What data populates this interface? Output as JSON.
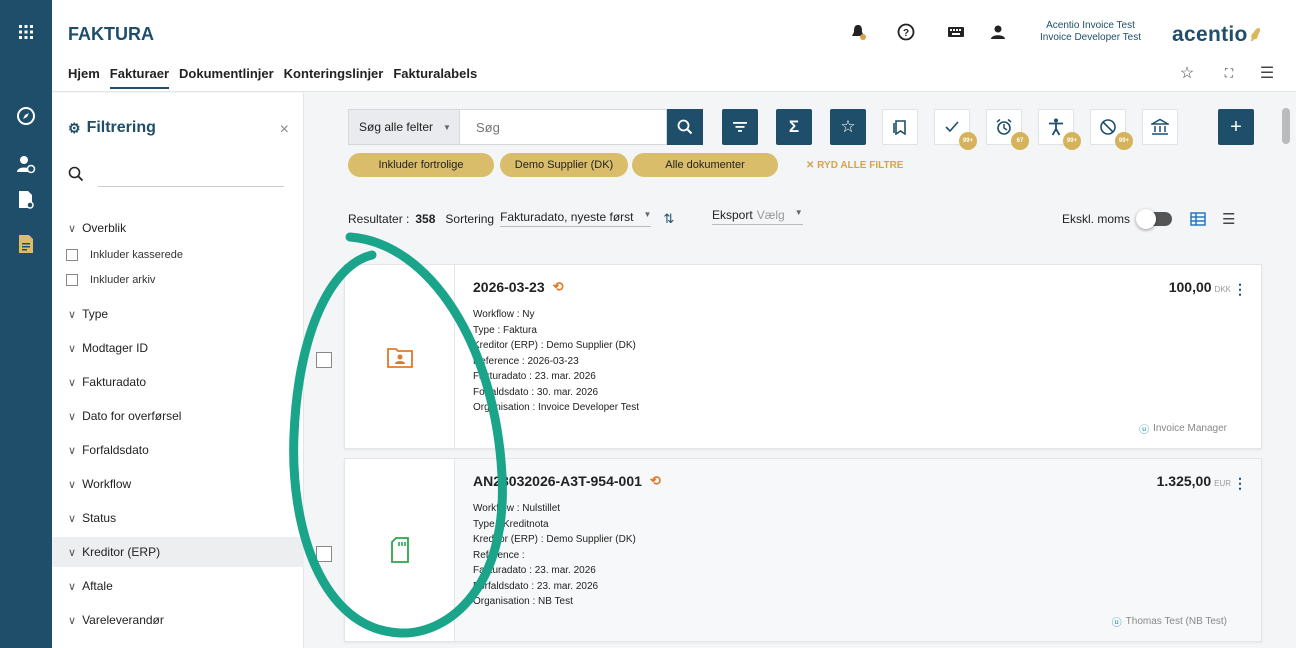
{
  "app": {
    "title": "FAKTURA"
  },
  "nav": {
    "items": [
      "Hjem",
      "Fakturaer",
      "Dokumentlinjer",
      "Konteringslinjer",
      "Fakturalabels"
    ]
  },
  "user": {
    "company": "Acentio Invoice Test",
    "org": "Invoice Developer Test"
  },
  "logo": {
    "text": "acentio"
  },
  "colors": {
    "primary": "#1f4e6b",
    "chip": "#d9bd6a",
    "accent": "#e07a2b",
    "annotation": "#1aa58a"
  },
  "filter": {
    "title": "Filtrering",
    "overblik": "Overblik",
    "checks": [
      "Inkluder kasserede",
      "Inkluder arkiv"
    ],
    "sections": [
      "Type",
      "Modtager ID",
      "Fakturadato",
      "Dato for overførsel",
      "Forfaldsdato",
      "Workflow",
      "Status",
      "Kreditor (ERP)",
      "Aftale",
      "Vareleverandør"
    ]
  },
  "search": {
    "type": "Søg alle felter",
    "placeholder": "Søg"
  },
  "badges": {
    "check": "99+",
    "alarm": "67",
    "access": "99+",
    "block": "99+"
  },
  "chips": [
    "Inkluder fortrolige",
    "Demo Supplier (DK)",
    "Alle dokumenter"
  ],
  "clear_filters": "RYD ALLE FILTRE",
  "results": {
    "label": "Resultater :",
    "count": "358",
    "sort_label": "Sortering",
    "sort_value": "Fakturadato, nyeste først",
    "export_label": "Eksport",
    "export_value": "Vælg",
    "exkl_label": "Ekskl. moms"
  },
  "cards": [
    {
      "title": "2026-03-23",
      "lines": [
        "Workflow : Ny",
        "Type : Faktura",
        "Kreditor (ERP) : Demo Supplier (DK)",
        "Reference : 2026-03-23",
        "Fakturadato : 23. mar. 2026",
        "Forfaldsdato : 30. mar. 2026",
        "Organisation : Invoice Developer Test"
      ],
      "amount": "100,00",
      "currency": "DKK",
      "owner": "Invoice Manager",
      "icon": "folder-user-icon"
    },
    {
      "title": "AN23032026-A3T-954-001",
      "lines": [
        "Workflow : Nulstillet",
        "Type : Kreditnota",
        "Kreditor (ERP) : Demo Supplier (DK)",
        "Reference :",
        "Fakturadato : 23. mar. 2026",
        "Forfaldsdato : 23. mar. 2026",
        "Organisation : NB Test"
      ],
      "amount": "1.325,00",
      "currency": "EUR",
      "owner": "Thomas Test (NB Test)",
      "icon": "sd-card-icon"
    }
  ]
}
